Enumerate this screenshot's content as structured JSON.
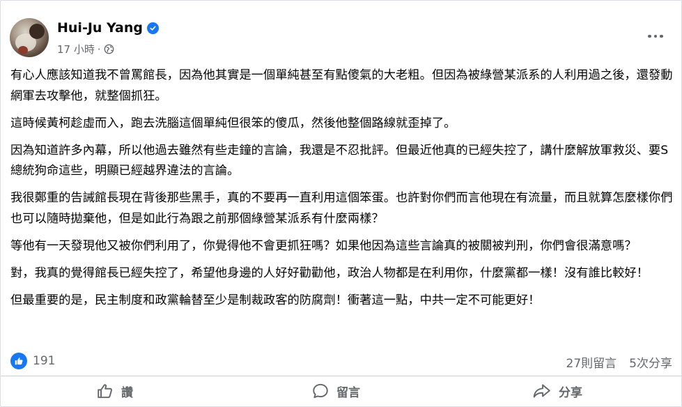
{
  "post": {
    "author": "Hui-Ju Yang",
    "timestamp": "17 小時",
    "separator": "·",
    "paragraphs": [
      "有心人應該知道我不曾罵館長，因為他其實是一個單純甚至有點傻氣的大老粗。但因為被綠營某派系的人利用過之後，還發動網軍去攻擊他，就整個抓狂。",
      "這時候黃柯趁虛而入，跑去洗腦這個單純但很笨的傻瓜，然後他整個路線就歪掉了。",
      "因為知道許多內幕，所以他過去雖然有些走鐘的言論，我還是不忍批評。但最近他真的已經失控了，講什麼解放軍救災、要S總統狗命這些，明顯已經越界違法的言論。",
      "我很鄭重的告誡館長現在背後那些黑手，真的不要再一直利用這個笨蛋。也許對你們而言他現在有流量，而且就算怎麼樣你們也可以隨時拋棄他，但是如此行為跟之前那個綠營某派系有什麼兩樣？",
      "等他有一天發現他又被你們利用了，你覺得他不會更抓狂嗎？如果他因為這些言論真的被關被判刑，你們會很滿意嗎？",
      "對，我真的覺得館長已經失控了，希望他身邊的人好好勸勸他，政治人物都是在利用你，什麼黨都一樣！沒有誰比較好！",
      "但最重要的是，民主制度和政黨輪替至少是制裁政客的防腐劑！衝著這一點，中共一定不可能更好！"
    ]
  },
  "stats": {
    "likes": "191",
    "comments": "27則留言",
    "shares": "5次分享"
  },
  "actions": {
    "like": "讚",
    "comment": "留言",
    "share": "分享"
  },
  "icons": {
    "verified": "verified-badge-icon",
    "audience": "globe-icon",
    "more": "more-options-icon",
    "like": "thumbs-up-icon",
    "comment": "speech-bubble-icon",
    "share": "share-arrow-icon"
  },
  "colors": {
    "accent": "#1877f2",
    "secondary_text": "#65676b",
    "primary_text": "#050505",
    "divider": "#ced0d4"
  }
}
